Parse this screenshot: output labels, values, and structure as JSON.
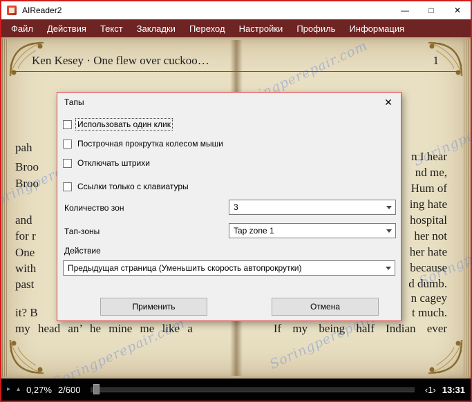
{
  "window": {
    "title": "AIReader2",
    "minimize": "—",
    "maximize": "□",
    "close": "✕"
  },
  "menu": {
    "items": [
      "Файл",
      "Действия",
      "Текст",
      "Закладки",
      "Переход",
      "Настройки",
      "Профиль",
      "Информация"
    ]
  },
  "book": {
    "header": "Ken Kesey  · One flew over cuckoo…",
    "page_number": "1",
    "watermark": "Soringperepair.com",
    "left_fragments": [
      "pah",
      "Broo",
      "Broo",
      "and",
      "for r",
      "One",
      "with",
      "past",
      "it? B"
    ],
    "left_bottom_line": "my head an’ he mine me like a",
    "right_fragments": [
      "n I hear",
      "nd me,",
      "Hum of",
      "ing hate",
      "hospital",
      "her not",
      "her hate",
      "because",
      "d dumb.",
      "n cagey",
      "t much."
    ],
    "right_bottom_line": "If my being half Indian ever"
  },
  "dialog": {
    "title": "Тапы",
    "close": "✕",
    "checkboxes": [
      {
        "label": "Использовать один клик",
        "checked": false
      },
      {
        "label": "Построчная прокрутка колесом мыши",
        "checked": false
      },
      {
        "label": "Отключать штрихи",
        "checked": false
      },
      {
        "label": "Ссылки только с клавиатуры",
        "checked": false
      }
    ],
    "zones_label": "Количество зон",
    "zones_value": "3",
    "tapzones_label": "Тап-зоны",
    "tapzones_value": "Tap zone 1",
    "action_label": "Действие",
    "action_value": "Предыдущая страница (Уменьшить скорость автопрокрутки)",
    "apply_label": "Применить",
    "cancel_label": "Отмена"
  },
  "statusbar": {
    "icon1": "▸",
    "icon2": "▴",
    "percent": "0,27%",
    "page": "2/600",
    "chapter": "‹1›",
    "time": "13:31"
  }
}
